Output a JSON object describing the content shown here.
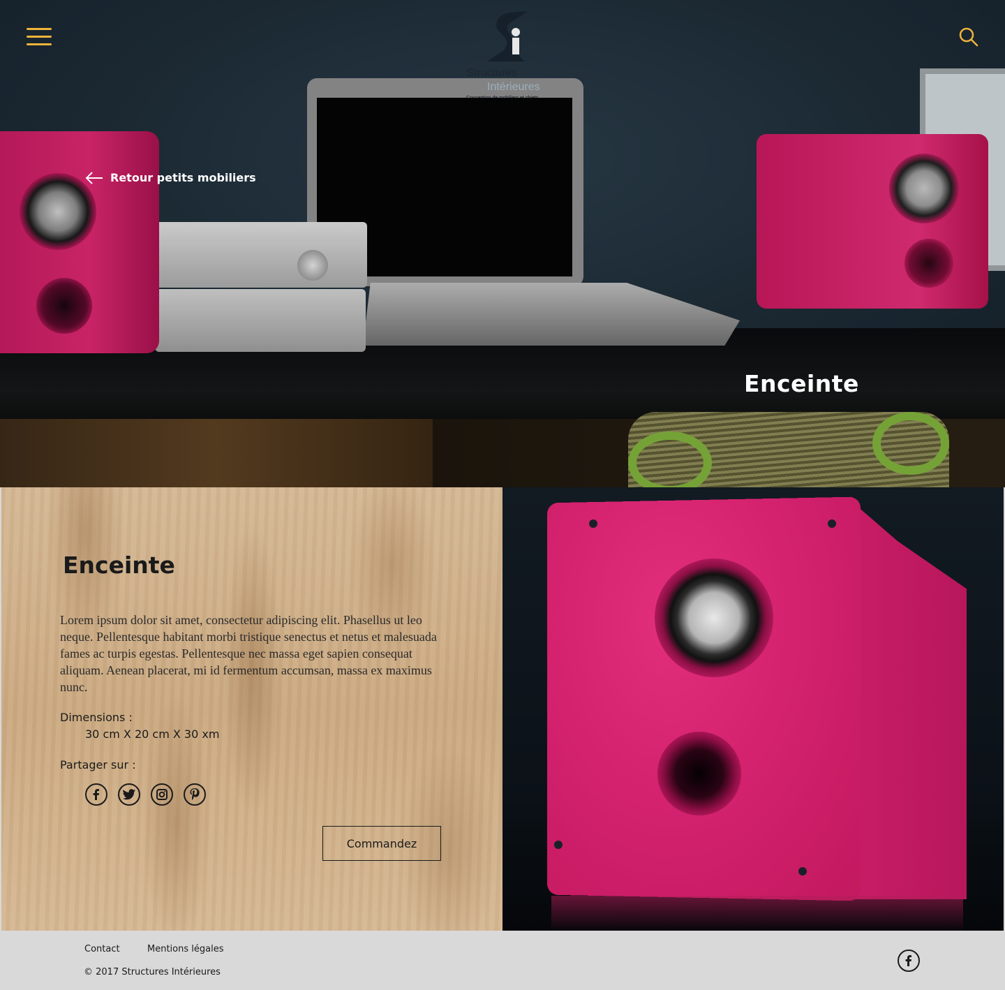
{
  "header": {
    "menu_icon": "hamburger-icon",
    "search_icon": "search-icon",
    "accent_color": "#f0b43c",
    "logo": {
      "line1": "Structures",
      "line2": "Intérieures",
      "tagline": "Conception de mobiliers et objets"
    }
  },
  "hero": {
    "back_link_label": "Retour petits mobiliers",
    "back_icon": "arrow-left-icon",
    "title": "Enceinte"
  },
  "product": {
    "title": "Enceinte",
    "description": "Lorem ipsum dolor sit amet, consectetur adipiscing elit. Phasellus ut leo neque. Pellentesque habitant morbi tristique senectus et netus et malesuada fames ac turpis egestas. Pellentesque nec massa eget sapien consequat aliquam. Aenean placerat, mi id fermentum accumsan, massa ex maximus nunc.",
    "dimensions_label": "Dimensions :",
    "dimensions_value": "30 cm X 20 cm X 30 xm",
    "share_label": "Partager sur :",
    "share_icons": [
      "facebook-icon",
      "twitter-icon",
      "instagram-icon",
      "pinterest-icon"
    ],
    "order_label": "Commandez"
  },
  "footer": {
    "contact_label": "Contact",
    "legal_label": "Mentions légales",
    "copyright": "© 2017 Structures Intérieures",
    "social_icon": "facebook-icon"
  }
}
